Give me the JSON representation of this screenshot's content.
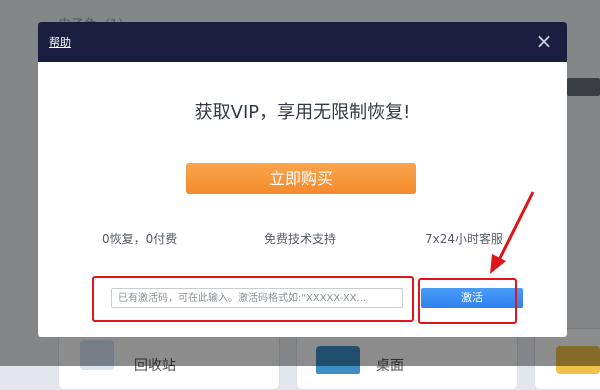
{
  "background": {
    "title": "电子免（1）",
    "items": [
      "回收站",
      "桌面"
    ]
  },
  "dialog": {
    "help_label": "帮助",
    "close_symbol": "×",
    "title": "获取VIP，享用无限制恢复!",
    "buy_label": "立即购买",
    "features": [
      "0恢复，0付费",
      "免费技术支持",
      "7x24小时客服"
    ],
    "code_placeholder": "已有激活码，可在此输入。激活码格式如:\"XXXXX-XX...",
    "activate_label": "激活"
  },
  "colors": {
    "header": "#1a1f3f",
    "buy_button": "#f7963a",
    "activate_button": "#3c8ef3",
    "annotation": "#e0151b"
  },
  "icons": {
    "close": "close-icon",
    "arrow": "red-arrow-annotation"
  }
}
